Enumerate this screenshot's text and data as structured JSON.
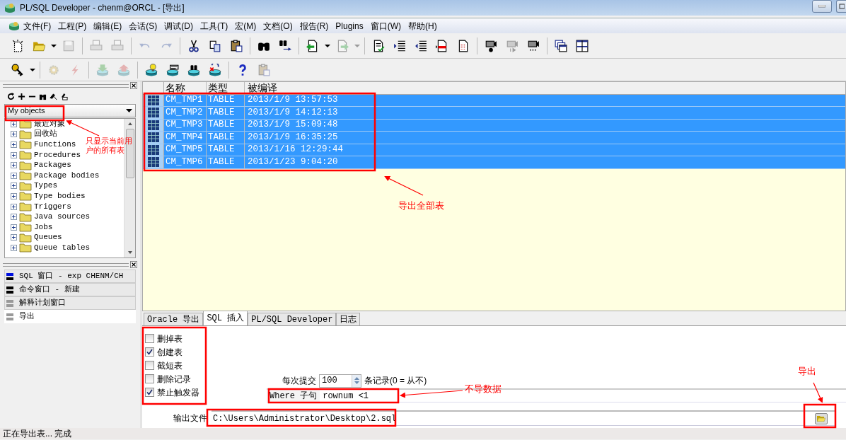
{
  "window": {
    "title": "PL/SQL Developer - chenm@ORCL - [导出]"
  },
  "menu": [
    "文件(F)",
    "工程(P)",
    "编辑(E)",
    "会话(S)",
    "调试(D)",
    "工具(T)",
    "宏(M)",
    "文档(O)",
    "报告(R)",
    "Plugins",
    "窗口(W)",
    "帮助(H)"
  ],
  "toolbars": [
    [
      {
        "kind": "new",
        "disabled": false
      },
      {
        "kind": "open",
        "disabled": false
      },
      {
        "kind": "dropdown",
        "disabled": false
      },
      {
        "kind": "save",
        "disabled": true
      },
      {
        "kind": "separator"
      },
      {
        "kind": "print",
        "disabled": true
      },
      {
        "kind": "print",
        "disabled": true
      },
      {
        "kind": "separator"
      },
      {
        "kind": "undo",
        "disabled": true
      },
      {
        "kind": "redo",
        "disabled": true
      },
      {
        "kind": "separator"
      },
      {
        "kind": "cut",
        "disabled": false
      },
      {
        "kind": "copy",
        "disabled": false
      },
      {
        "kind": "paste",
        "disabled": false
      },
      {
        "kind": "separator"
      },
      {
        "kind": "find",
        "disabled": false
      },
      {
        "kind": "findnext",
        "disabled": false
      },
      {
        "kind": "separator"
      },
      {
        "kind": "load",
        "disabled": false
      },
      {
        "kind": "dropdown",
        "disabled": false
      },
      {
        "kind": "forward",
        "disabled": true
      },
      {
        "kind": "dropdown",
        "disabled": true
      },
      {
        "kind": "separator"
      },
      {
        "kind": "compile",
        "disabled": false
      },
      {
        "kind": "indent",
        "disabled": false
      },
      {
        "kind": "outdent",
        "disabled": false
      },
      {
        "kind": "stripe",
        "disabled": false
      },
      {
        "kind": "doc",
        "disabled": false
      },
      {
        "kind": "separator"
      },
      {
        "kind": "record",
        "disabled": false
      },
      {
        "kind": "play",
        "disabled": true
      },
      {
        "kind": "camera",
        "disabled": false
      },
      {
        "kind": "separator"
      },
      {
        "kind": "cascade",
        "disabled": false
      },
      {
        "kind": "tile",
        "disabled": false
      }
    ],
    [
      {
        "kind": "key",
        "disabled": false
      },
      {
        "kind": "dropdown",
        "disabled": false
      },
      {
        "kind": "separator"
      },
      {
        "kind": "gear",
        "disabled": true
      },
      {
        "kind": "lightning",
        "disabled": true
      },
      {
        "kind": "separator"
      },
      {
        "kind": "dbdown",
        "disabled": true
      },
      {
        "kind": "dbup",
        "disabled": true
      },
      {
        "kind": "separator"
      },
      {
        "kind": "dbbulb",
        "disabled": false
      },
      {
        "kind": "dbsql",
        "disabled": false
      },
      {
        "kind": "dbfind",
        "disabled": false
      },
      {
        "kind": "dbx",
        "disabled": false
      },
      {
        "kind": "separator"
      },
      {
        "kind": "help",
        "disabled": false
      },
      {
        "kind": "paste",
        "disabled": true
      }
    ]
  ],
  "object_browser": {
    "filter": "My objects",
    "tree": [
      {
        "label": "最近对象",
        "expanded": false
      },
      {
        "label": "回收站",
        "expanded": false
      },
      {
        "label": "Functions",
        "expanded": false
      },
      {
        "label": "Procedures",
        "expanded": false
      },
      {
        "label": "Packages",
        "expanded": false
      },
      {
        "label": "Package bodies",
        "expanded": false
      },
      {
        "label": "Types",
        "expanded": false
      },
      {
        "label": "Type bodies",
        "expanded": false
      },
      {
        "label": "Triggers",
        "expanded": false
      },
      {
        "label": "Java sources",
        "expanded": false
      },
      {
        "label": "Jobs",
        "expanded": false
      },
      {
        "label": "Queues",
        "expanded": false
      },
      {
        "label": "Queue tables",
        "expanded": false
      }
    ]
  },
  "window_list": [
    {
      "label": "SQL 窗口 - exp CHENM/CH",
      "kind": "sql",
      "selected": false
    },
    {
      "label": "命令窗口 - 新建",
      "kind": "command",
      "selected": false
    },
    {
      "label": "解释计划窗口",
      "kind": "plan",
      "selected": false
    },
    {
      "label": "导出",
      "kind": "plan",
      "selected": true
    }
  ],
  "table": {
    "columns": [
      "名称",
      "类型",
      "被编译"
    ],
    "rows": [
      {
        "cells": [
          "CM_TMP1",
          "TABLE",
          "2013/1/9 13:57:53"
        ],
        "selected": true
      },
      {
        "cells": [
          "CM_TMP2",
          "TABLE",
          "2013/1/9 14:12:13"
        ],
        "selected": true
      },
      {
        "cells": [
          "CM_TMP3",
          "TABLE",
          "2013/1/9 15:09:48"
        ],
        "selected": true
      },
      {
        "cells": [
          "CM_TMP4",
          "TABLE",
          "2013/1/9 16:35:25"
        ],
        "selected": true
      },
      {
        "cells": [
          "CM_TMP5",
          "TABLE",
          "2013/1/16 12:29:44"
        ],
        "selected": true
      },
      {
        "cells": [
          "CM_TMP6",
          "TABLE",
          "2013/1/23 9:04:20"
        ],
        "selected": true
      }
    ]
  },
  "export_tabs": [
    {
      "label": "Oracle 导出",
      "selected": false
    },
    {
      "label": "SQL 插入",
      "selected": true
    },
    {
      "label": "PL/SQL Developer",
      "selected": false
    },
    {
      "label": "日志",
      "selected": false
    }
  ],
  "options": [
    {
      "label": "删掉表",
      "checked": false
    },
    {
      "label": "创建表",
      "checked": true
    },
    {
      "label": "截短表",
      "checked": false
    },
    {
      "label": "删除记录",
      "checked": false
    },
    {
      "label": "禁止触发器",
      "checked": true
    }
  ],
  "commit": {
    "label": "每次提交",
    "value": "100",
    "suffix": "条记录(0 = 从不)"
  },
  "where": {
    "label": "Where 子句",
    "value": "rownum <1"
  },
  "output_file": {
    "label": "输出文件",
    "value": "C:\\Users\\Administrator\\Desktop\\2.sql"
  },
  "status_bar": "正在导出表... 完成",
  "annotations": [
    {
      "text": "只显示当前用户的所有表"
    },
    {
      "text": "导出全部表"
    },
    {
      "text": "不导数据"
    },
    {
      "text": "导出"
    }
  ]
}
